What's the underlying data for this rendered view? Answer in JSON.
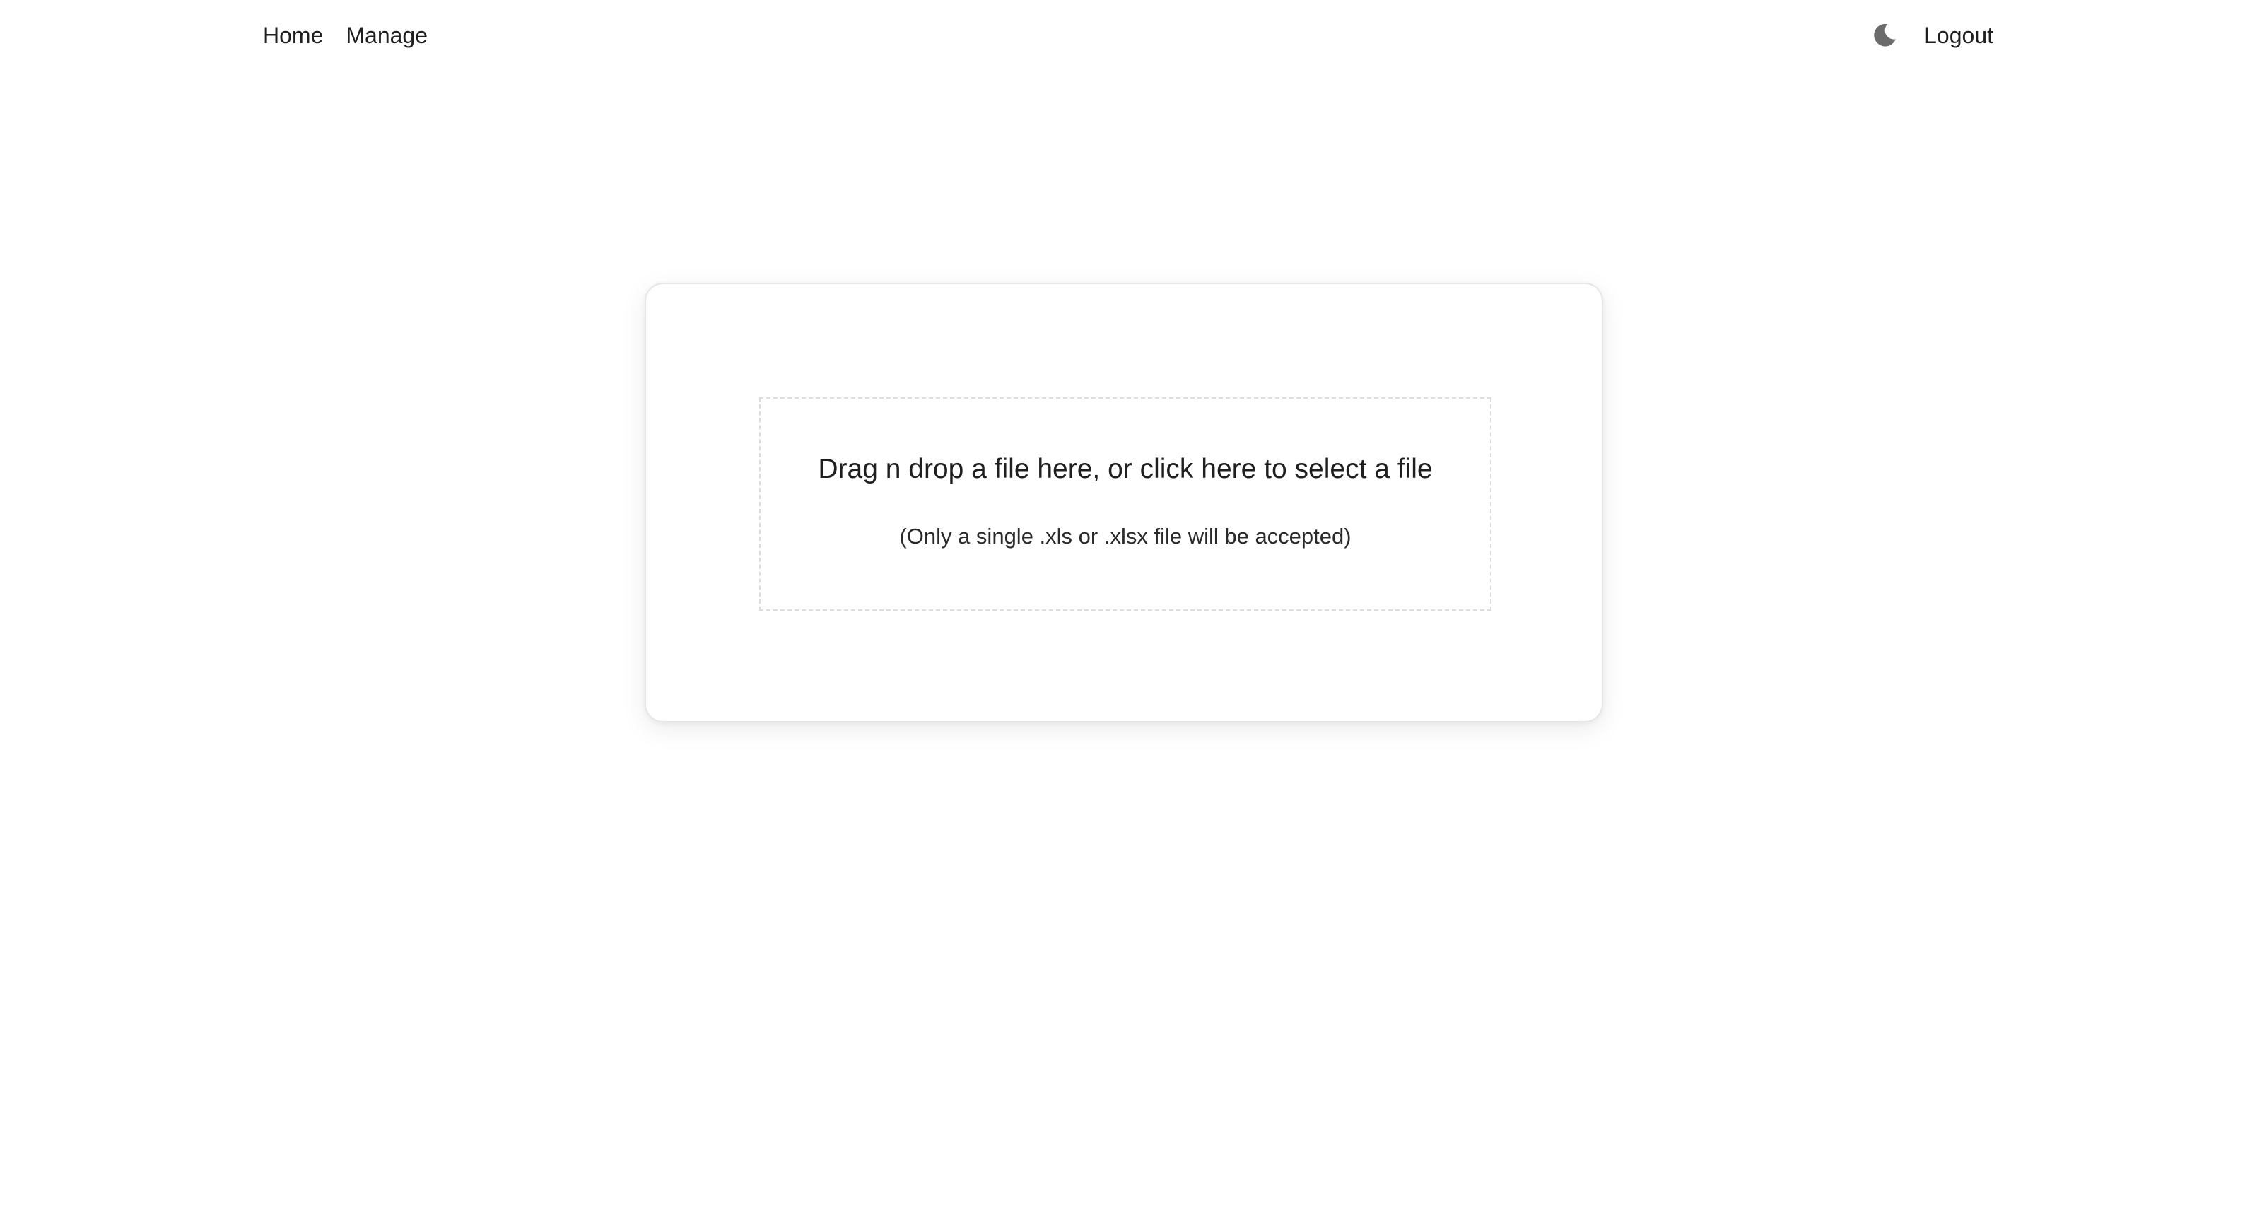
{
  "nav": {
    "home_label": "Home",
    "manage_label": "Manage",
    "theme_icon": "moon-icon",
    "logout_label": "Logout"
  },
  "upload": {
    "prompt": "Drag n drop a file here, or click here to select a file",
    "note": "(Only a single .xls or .xlsx file will be accepted)"
  },
  "colors": {
    "text": "#1f1f1f",
    "moon_icon": "#6b6b6b",
    "card_border": "#e6e6e6",
    "dropzone_border": "#dcdcdc"
  }
}
